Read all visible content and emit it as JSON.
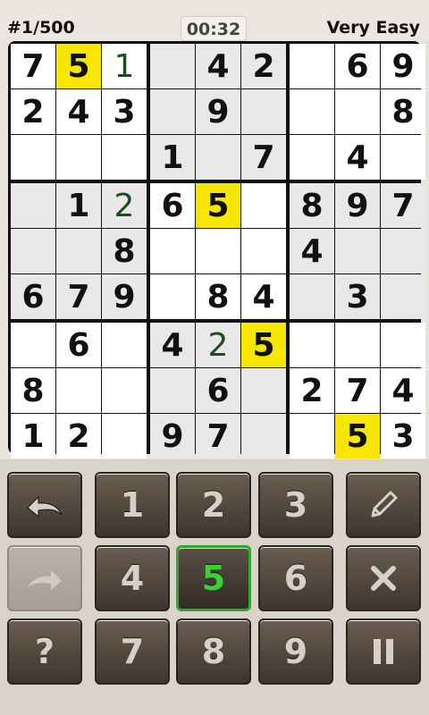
{
  "header": {
    "puzzle_number": "#1/500",
    "timer": "00:32",
    "difficulty": "Very Easy"
  },
  "board": {
    "cells": [
      [
        "7",
        "5",
        "1",
        "",
        "4",
        "2",
        "",
        "6",
        "9"
      ],
      [
        "2",
        "4",
        "3",
        "",
        "9",
        "",
        "",
        "",
        "8"
      ],
      [
        "",
        "",
        "",
        "1",
        "",
        "7",
        "",
        "4",
        ""
      ],
      [
        "",
        "1",
        "2",
        "6",
        "5",
        "",
        "8",
        "9",
        "7"
      ],
      [
        "",
        "",
        "8",
        "",
        "",
        "",
        "4",
        "",
        ""
      ],
      [
        "6",
        "7",
        "9",
        "",
        "8",
        "4",
        "",
        "3",
        ""
      ],
      [
        "",
        "6",
        "",
        "4",
        "2",
        "5",
        "",
        "",
        ""
      ],
      [
        "8",
        "",
        "",
        "",
        "6",
        "",
        "2",
        "7",
        "4"
      ],
      [
        "1",
        "2",
        "",
        "9",
        "7",
        "",
        "",
        "5",
        "3"
      ]
    ],
    "user_entered": [
      [
        0,
        2
      ],
      [
        3,
        2
      ],
      [
        6,
        4
      ]
    ],
    "highlighted": [
      [
        0,
        1
      ],
      [
        3,
        4
      ],
      [
        6,
        5
      ],
      [
        8,
        7
      ]
    ],
    "highlighted_digit": "5",
    "colors": {
      "highlight": "#f6e600",
      "given_digit": "#111111",
      "user_digit": "#1e4d1e",
      "cell_white": "#ffffff",
      "cell_gray": "#e8e8e8"
    }
  },
  "keypad": {
    "selected_digit": "5",
    "selected_color": "#3ad03a",
    "buttons": [
      {
        "label": "",
        "icon": "undo-icon"
      },
      {
        "label": "1"
      },
      {
        "label": "2"
      },
      {
        "label": "3"
      },
      {
        "label": "",
        "icon": "pencil-icon"
      },
      {
        "label": "",
        "icon": "redo-icon",
        "disabled": true
      },
      {
        "label": "4"
      },
      {
        "label": "5",
        "selected": true
      },
      {
        "label": "6"
      },
      {
        "label": "",
        "icon": "erase-x-icon"
      },
      {
        "label": "?",
        "icon": "hint-icon"
      },
      {
        "label": "7"
      },
      {
        "label": "8"
      },
      {
        "label": "9"
      },
      {
        "label": "",
        "icon": "pause-icon"
      }
    ]
  }
}
